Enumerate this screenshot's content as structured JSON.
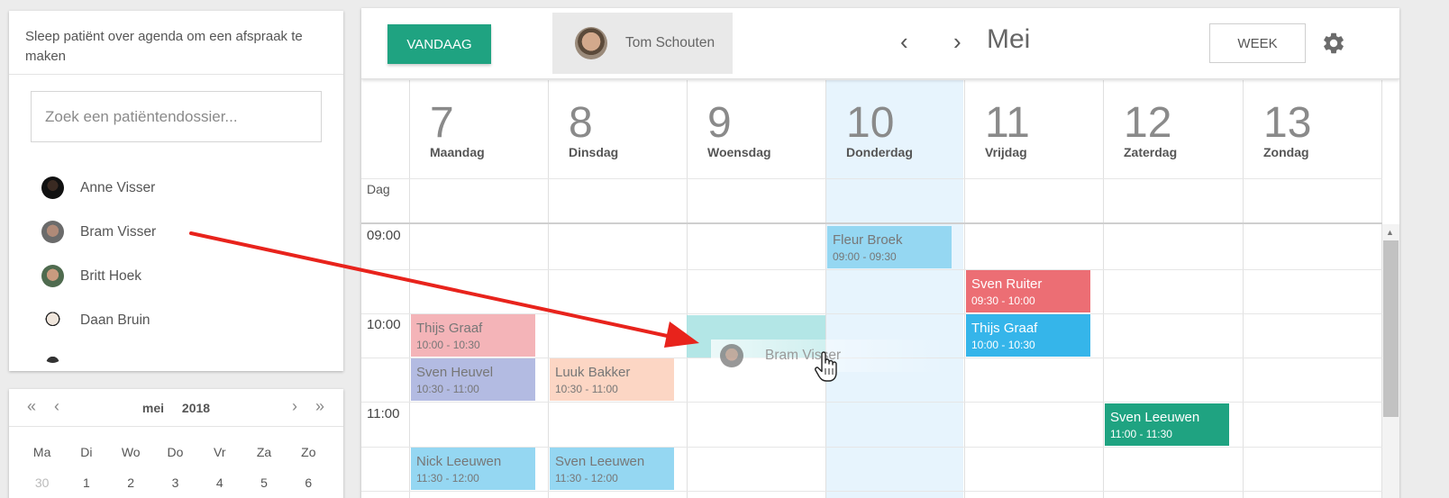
{
  "sidebar": {
    "instruction": "Sleep patiënt over agenda om een afspraak te maken",
    "search_placeholder": "Zoek een patiëntendossier...",
    "patients": [
      {
        "name": "Anne Visser"
      },
      {
        "name": "Bram Visser"
      },
      {
        "name": "Britt Hoek"
      },
      {
        "name": "Daan Bruin"
      }
    ]
  },
  "mini_calendar": {
    "month": "mei",
    "year": "2018",
    "nav": {
      "first": "«",
      "prev": "‹",
      "next": "›",
      "last": "»"
    },
    "weekdays": [
      "Ma",
      "Di",
      "Wo",
      "Do",
      "Vr",
      "Za",
      "Zo"
    ],
    "first_row": [
      "30",
      "1",
      "2",
      "3",
      "4",
      "5",
      "6"
    ]
  },
  "toolbar": {
    "today_label": "VANDAAG",
    "doctor_name": "Tom Schouten",
    "prev_icon": "‹",
    "next_icon": "›",
    "month_label": "Mei",
    "view_label": "WEEK",
    "settings_icon": "gear-icon"
  },
  "calendar": {
    "all_day_label": "Dag",
    "days": [
      {
        "num": "7",
        "name": "Maandag"
      },
      {
        "num": "8",
        "name": "Dinsdag"
      },
      {
        "num": "9",
        "name": "Woensdag"
      },
      {
        "num": "10",
        "name": "Donderdag"
      },
      {
        "num": "11",
        "name": "Vrijdag"
      },
      {
        "num": "12",
        "name": "Zaterdag"
      },
      {
        "num": "13",
        "name": "Zondag"
      }
    ],
    "times": [
      "09:00",
      "10:00",
      "11:00"
    ],
    "events": [
      {
        "title": "Fleur Broek",
        "time": "09:00 - 09:30"
      },
      {
        "title": "Sven Ruiter",
        "time": "09:30 - 10:00"
      },
      {
        "title": "Thijs Graaf",
        "time": "10:00 - 10:30"
      },
      {
        "title": "Thijs Graaf",
        "time": "10:00 - 10:30"
      },
      {
        "title": "Sven Heuvel",
        "time": "10:30 - 11:00"
      },
      {
        "title": "Luuk Bakker",
        "time": "10:30 - 11:00"
      },
      {
        "title": "Sven Leeuwen",
        "time": "11:00 - 11:30"
      },
      {
        "title": "Nick Leeuwen",
        "time": "11:30 - 12:00"
      },
      {
        "title": "Sven Leeuwen",
        "time": "11:30 - 12:00"
      }
    ],
    "dragging": {
      "name": "Bram Visser"
    }
  },
  "colors": {
    "accent": "#1fa381",
    "today_column": "#e7f4fd",
    "arrow": "#e8231c"
  }
}
